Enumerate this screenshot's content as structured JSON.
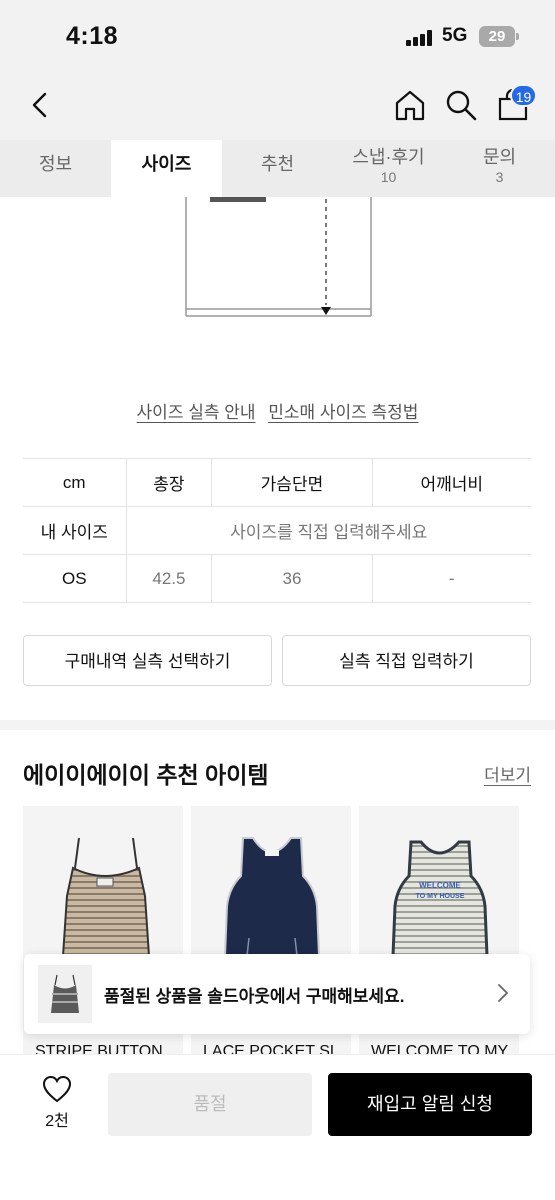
{
  "status_bar": {
    "time": "4:18",
    "network": "5G",
    "battery": "29"
  },
  "nav": {
    "cart_count": "19"
  },
  "tabs": [
    {
      "label": "정보",
      "sub": ""
    },
    {
      "label": "사이즈",
      "sub": ""
    },
    {
      "label": "추천",
      "sub": ""
    },
    {
      "label": "스냅·후기",
      "sub": "10"
    },
    {
      "label": "문의",
      "sub": "3"
    }
  ],
  "size_links": {
    "guide": "사이즈 실측 안내",
    "sleeveless": "민소매 사이즈 측정법"
  },
  "size_table": {
    "headers": [
      "cm",
      "총장",
      "가슴단면",
      "어깨너비"
    ],
    "my_size_label": "내 사이즈",
    "my_size_prompt": "사이즈를 직접 입력해주세요",
    "rows": [
      {
        "size": "OS",
        "length": "42.5",
        "chest": "36",
        "shoulder": "-"
      }
    ]
  },
  "buttons": {
    "purchase_history": "구매내역 실측 선택하기",
    "direct_input": "실측 직접 입력하기"
  },
  "recommend": {
    "title": "에이이에이이 추천 아이템",
    "more": "더보기",
    "products": [
      {
        "name": "STRIPE BUTTON"
      },
      {
        "name": "LACE POCKET SL"
      },
      {
        "name": "WELCOME TO MY"
      }
    ],
    "print_text_1": "WELCOME",
    "print_text_2": "TO MY HOUSE"
  },
  "toast": {
    "message": "품절된 상품을 솔드아웃에서 구매해보세요."
  },
  "bottom_bar": {
    "like_count": "2천",
    "soldout_label": "품절",
    "restock_label": "재입고 알림 신청"
  }
}
